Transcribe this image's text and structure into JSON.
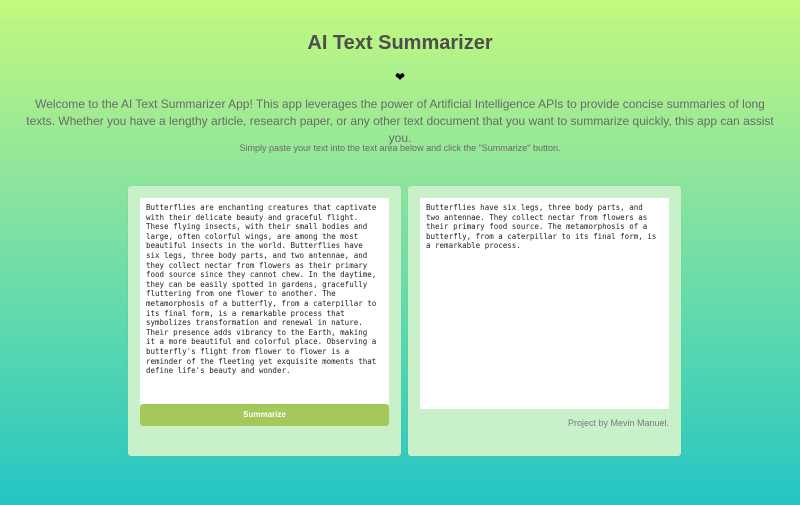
{
  "app": {
    "title": "AI Text Summarizer",
    "heart_glyph": "❤",
    "intro": "Welcome to the AI Text Summarizer App! This app leverages the power of Artificial Intelligence APIs to provide concise summaries of long texts. Whether you have a lengthy article, research paper, or any other text document that you want to summarize quickly, this app can assist you.",
    "instruction": "Simply paste your text into the text area below and click the \"Summarize\" button."
  },
  "input_panel": {
    "text": "Butterflies are enchanting creatures that captivate\nwith their delicate beauty and graceful flight.\nThese flying insects, with their small bodies and\nlarge, often colorful wings, are among the most\nbeautiful insects in the world. Butterflies have\nsix legs, three body parts, and two antennae, and\nthey collect nectar from flowers as their primary\nfood source since they cannot chew. In the daytime,\nthey can be easily spotted in gardens, gracefully\nfluttering from one flower to another. The\nmetamorphosis of a butterfly, from a caterpillar to\nits final form, is a remarkable process that\nsymbolizes transformation and renewal in nature.\nTheir presence adds vibrancy to the Earth, making\nit a more beautiful and colorful place. Observing a\nbutterfly's flight from flower to flower is a\nreminder of the fleeting yet exquisite moments that\ndefine life's beauty and wonder.",
    "button_label": "Summarize"
  },
  "output_panel": {
    "text": "Butterflies have six legs, three body parts, and\ntwo antennae. They collect nectar from flowers as\ntheir primary food source. The metamorphosis of a\nbutterfly, from a caterpillar to its final form, is\na remarkable process.",
    "credit": "Project by Mevin Manuel."
  },
  "colors": {
    "gradient_top": "#c3f97e",
    "gradient_bottom": "#25c5c4",
    "panel_bg": "#c8f0c9",
    "button_bg": "#a5c85a"
  }
}
